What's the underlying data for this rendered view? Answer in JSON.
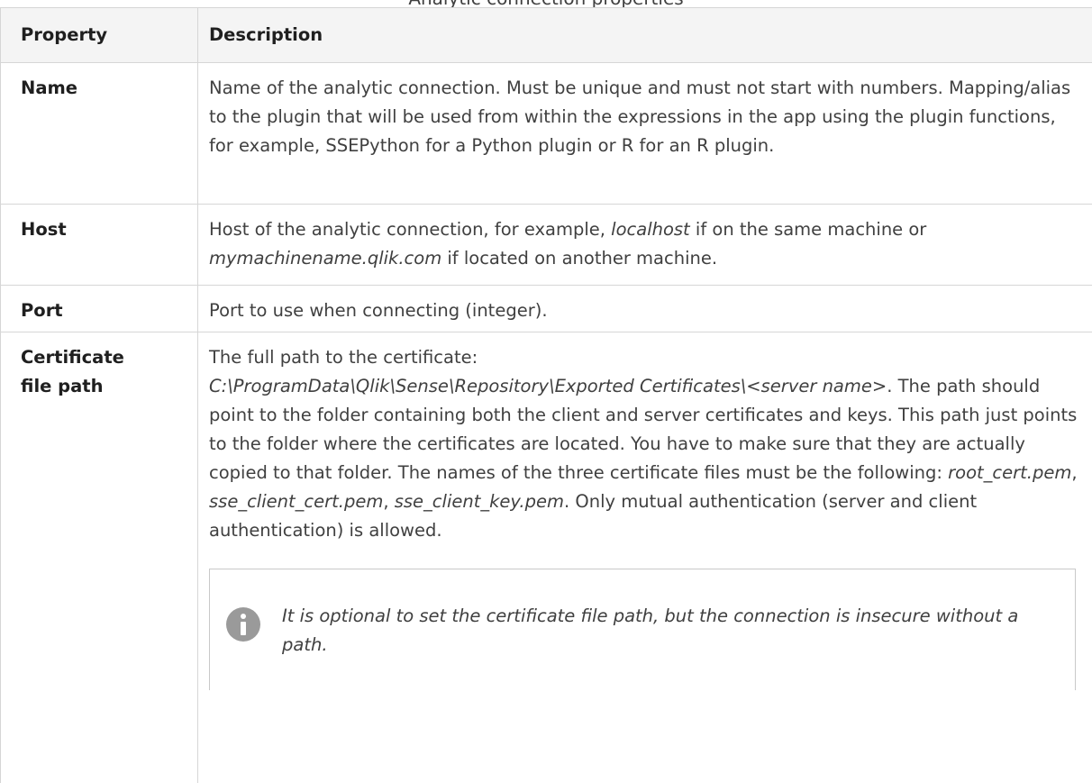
{
  "caption": "Analytic connection properties",
  "table": {
    "headers": {
      "property": "Property",
      "description": "Description"
    },
    "rows": {
      "name": {
        "property": "Name",
        "description": "Name of the analytic connection. Must be unique and must not start with numbers. Mapping/alias to the plugin that will be used from within the expressions in the app using the plugin functions, for example, SSEPython for a Python plugin or R for an R plugin."
      },
      "host": {
        "property": "Host",
        "desc_a": "Host of the analytic connection, for example, ",
        "desc_italic_1": "localhost",
        "desc_b": " if on the same machine or ",
        "desc_italic_2": "mymachinename.qlik.com",
        "desc_c": " if located on another machine."
      },
      "port": {
        "property": "Port",
        "description": "Port to use when connecting (integer)."
      },
      "cert": {
        "property_line1": "Certificate",
        "property_line2": "file path",
        "desc_intro": "The full path to the certificate:",
        "desc_path": "C:\\ProgramData\\Qlik\\Sense\\Repository\\Exported Certificates\\<server name>",
        "desc_path_end": ".",
        "desc_body": " The path should point to the folder containing both the client and server certificates and keys. This path just points to the folder where the certificates are located. You have to make sure that they are actually copied to that folder. The names of the three certificate files must be the following: ",
        "file_1": "root_cert.pem",
        "sep_1": ", ",
        "file_2": "sse_client_cert.pem",
        "sep_2": ", ",
        "file_3": "sse_client_key.pem",
        "desc_end": ". Only mutual authentication (server and client authentication) is allowed.",
        "note_icon": "info-icon",
        "note": "It is optional to set the certificate file path, but the connection is insecure without a path."
      }
    }
  }
}
